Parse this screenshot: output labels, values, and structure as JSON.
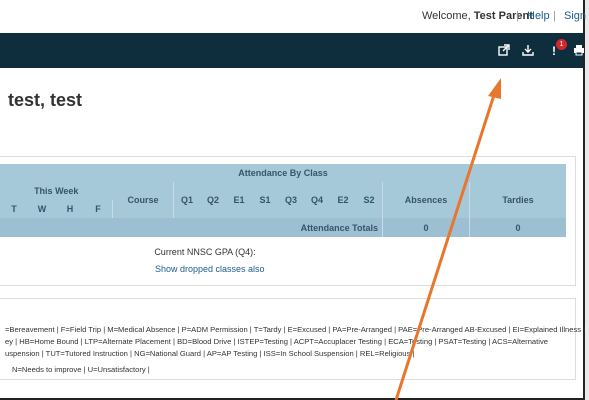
{
  "header": {
    "welcome_prefix": "Welcome,",
    "user_name": "Test Parent",
    "help": "Help",
    "signout": "Sign Out",
    "separator": "|"
  },
  "toolbar": {
    "icons": [
      "external-link-icon",
      "download-icon",
      "alert-icon",
      "print-icon"
    ],
    "alert_count": "1"
  },
  "page": {
    "title": "test, test"
  },
  "attendance": {
    "table_title": "Attendance By Class",
    "this_week": "This Week",
    "days": [
      "T",
      "W",
      "H",
      "F"
    ],
    "columns": [
      "Course",
      "Q1",
      "Q2",
      "E1",
      "S1",
      "Q3",
      "Q4",
      "E2",
      "S2",
      "Absences",
      "Tardies"
    ],
    "totals_label": "Attendance Totals",
    "absences_total": "0",
    "tardies_total": "0"
  },
  "gpa": {
    "label": "Current NNSC GPA (Q4):",
    "dropped_link": "Show dropped classes also"
  },
  "legend": {
    "lines": [
      "=Bereavement | F=Field Trip | M=Medical Absence | P=ADM Permission | T=Tardy | E=Excused | PA=Pre-Arranged | PAE=Pre-Arranged AB-Excused | EI=Explained Illness |",
      "ey | HB=Home Bound | LTP=Alternate Placement | BD=Blood Drive | ISTEP=Testing | ACPT=Accuplacer Testing | ECA=Testing | PSAT=Testing | ACS=Alternative",
      "uspension | TUT=Tutored Instruction | NG=National Guard | AP=AP Testing | ISS=In School Suspension | REL=Religious |",
      "N=Needs to improve | U=Unsatisfactory |"
    ]
  },
  "colors": {
    "navbar": "#0f2e3d",
    "table_header": "#a6c9d9",
    "link": "#1b5d8e",
    "annotation_arrow": "#e8772e",
    "badge": "#d0282d"
  }
}
